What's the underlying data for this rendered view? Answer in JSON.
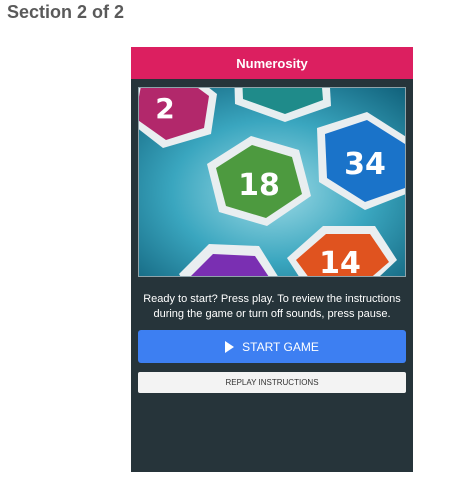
{
  "section": {
    "title": "Section 2 of 2"
  },
  "game": {
    "title": "Numerosity",
    "tiles": [
      "2",
      "18",
      "34",
      "14"
    ],
    "ready_text": "Ready to start? Press play. To review the instructions during the game or turn off sounds, press pause.",
    "start_label": "START GAME",
    "replay_label": "REPLAY INSTRUCTIONS"
  },
  "colors": {
    "header": "#dc1f60",
    "panel": "#26343a",
    "start_button": "#3d7ff2",
    "replay_button": "#f3f3f3"
  },
  "icons": {
    "play": "play-icon"
  }
}
